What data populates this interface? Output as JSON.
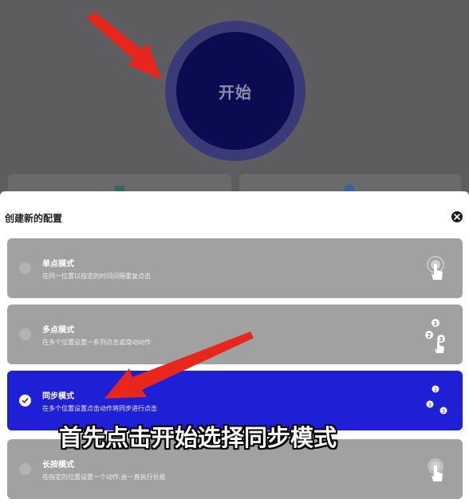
{
  "background": {
    "start_button_label": "开始"
  },
  "sheet": {
    "title": "创建新的配置",
    "modes": [
      {
        "name": "单点模式",
        "description": "在同一位置以指定的时间间隔重复点击",
        "selected": false,
        "icon": "single-tap-icon"
      },
      {
        "name": "多点模式",
        "description": "在多个位置设置一系列点击或滑动动作",
        "selected": false,
        "icon": "multi-tap-icon"
      },
      {
        "name": "同步模式",
        "description": "在多个位置设置点击动作将同步进行点击",
        "selected": true,
        "icon": "sync-tap-icon"
      },
      {
        "name": "长按模式",
        "description": "在指定的位置设置一个动作,会一直执行长按",
        "selected": false,
        "icon": "long-press-icon"
      }
    ]
  },
  "overlay": {
    "caption": "首先点击开始选择同步模式"
  },
  "colors": {
    "accent": "#1f1fd6",
    "start_button": "#0b0b52",
    "arrow": "#e8261c",
    "card": "#a1a1a1",
    "dim_background": "#5d5d5f"
  }
}
